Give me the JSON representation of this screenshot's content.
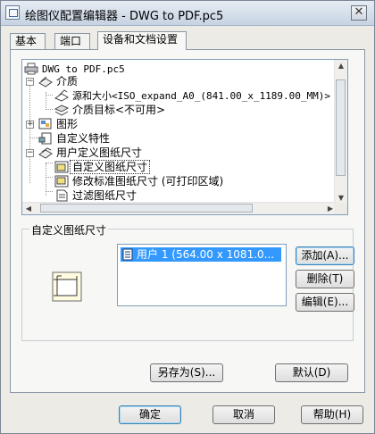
{
  "window": {
    "title": "绘图仪配置编辑器 - DWG to PDF.pc5",
    "close_label": "✕"
  },
  "tabs": [
    {
      "label": "基本"
    },
    {
      "label": "端口"
    },
    {
      "label": "设备和文档设置"
    }
  ],
  "tree": {
    "items": [
      {
        "label": "DWG to PDF.pc5"
      },
      {
        "label": "介质"
      },
      {
        "label": "源和大小<ISO_expand_A0_(841.00_x_1189.00_MM)>"
      },
      {
        "label": "介质目标<不可用>"
      },
      {
        "label": "图形"
      },
      {
        "label": "自定义特性"
      },
      {
        "label": "用户定义图纸尺寸"
      },
      {
        "label": "自定义图纸尺寸"
      },
      {
        "label": "修改标准图纸尺寸  (可打印区域)"
      },
      {
        "label": "过滤图纸尺寸"
      }
    ],
    "expander_minus": "−",
    "expander_plus": "+"
  },
  "custom_size_group": {
    "label": "自定义图纸尺寸",
    "list_items": [
      "用户 1 (564.00 x 1081.0..."
    ],
    "add_label": "添加(A)...",
    "delete_label": "删除(T)",
    "edit_label": "编辑(E)..."
  },
  "panel_buttons": {
    "save_as_label": "另存为(S)...",
    "default_label": "默认(D)"
  },
  "dialog_buttons": {
    "ok_label": "确定",
    "cancel_label": "取消",
    "help_label": "帮助(H)"
  },
  "colors": {
    "selection": "#3399ff",
    "title_bar": "#c7d3e2"
  },
  "icons": {
    "root": "plotter-icon",
    "media": "media-icon",
    "source": "paper-source-icon",
    "destination": "media-destination-icon",
    "graphics": "graphics-icon",
    "custom_props": "custom-properties-icon",
    "user_sizes": "user-sizes-icon",
    "custom_size": "custom-paper-icon",
    "modify_std": "modify-paper-icon",
    "filter": "filter-paper-icon",
    "big": "paper-size-icon"
  }
}
